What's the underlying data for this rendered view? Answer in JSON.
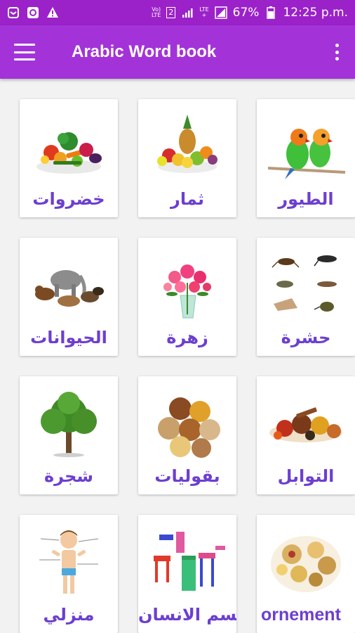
{
  "status_bar": {
    "volte_top": "Vo)",
    "volte_bottom": "LTE",
    "sim": "2",
    "lte_top": "LTE",
    "lte_bottom": "+",
    "battery_percent": "67%",
    "time": "12:25 p.m.",
    "icons": [
      "notification-icon",
      "chat-icon",
      "warning-icon",
      "signal-icon",
      "battery-icon"
    ]
  },
  "app_bar": {
    "title": "Arabic Word book",
    "menu_icon": "hamburger-menu-icon",
    "overflow_icon": "more-vert-icon"
  },
  "categories": [
    {
      "label": "خضروات",
      "icon": "vegetables-image"
    },
    {
      "label": "ثمار",
      "icon": "fruits-image"
    },
    {
      "label": "الطيور",
      "icon": "birds-image"
    },
    {
      "label": "الحيوانات",
      "icon": "animals-image"
    },
    {
      "label": "زهرة",
      "icon": "flower-image"
    },
    {
      "label": "حشرة",
      "icon": "insects-image"
    },
    {
      "label": "شجرة",
      "icon": "tree-image"
    },
    {
      "label": "بقوليات",
      "icon": "legumes-image"
    },
    {
      "label": "التوابل",
      "icon": "spices-image"
    },
    {
      "label": "منزلي",
      "icon": "body-image"
    },
    {
      "label": "جسم الانسان",
      "icon": "furniture-image"
    },
    {
      "label": "ornement",
      "icon": "ornament-image"
    }
  ]
}
